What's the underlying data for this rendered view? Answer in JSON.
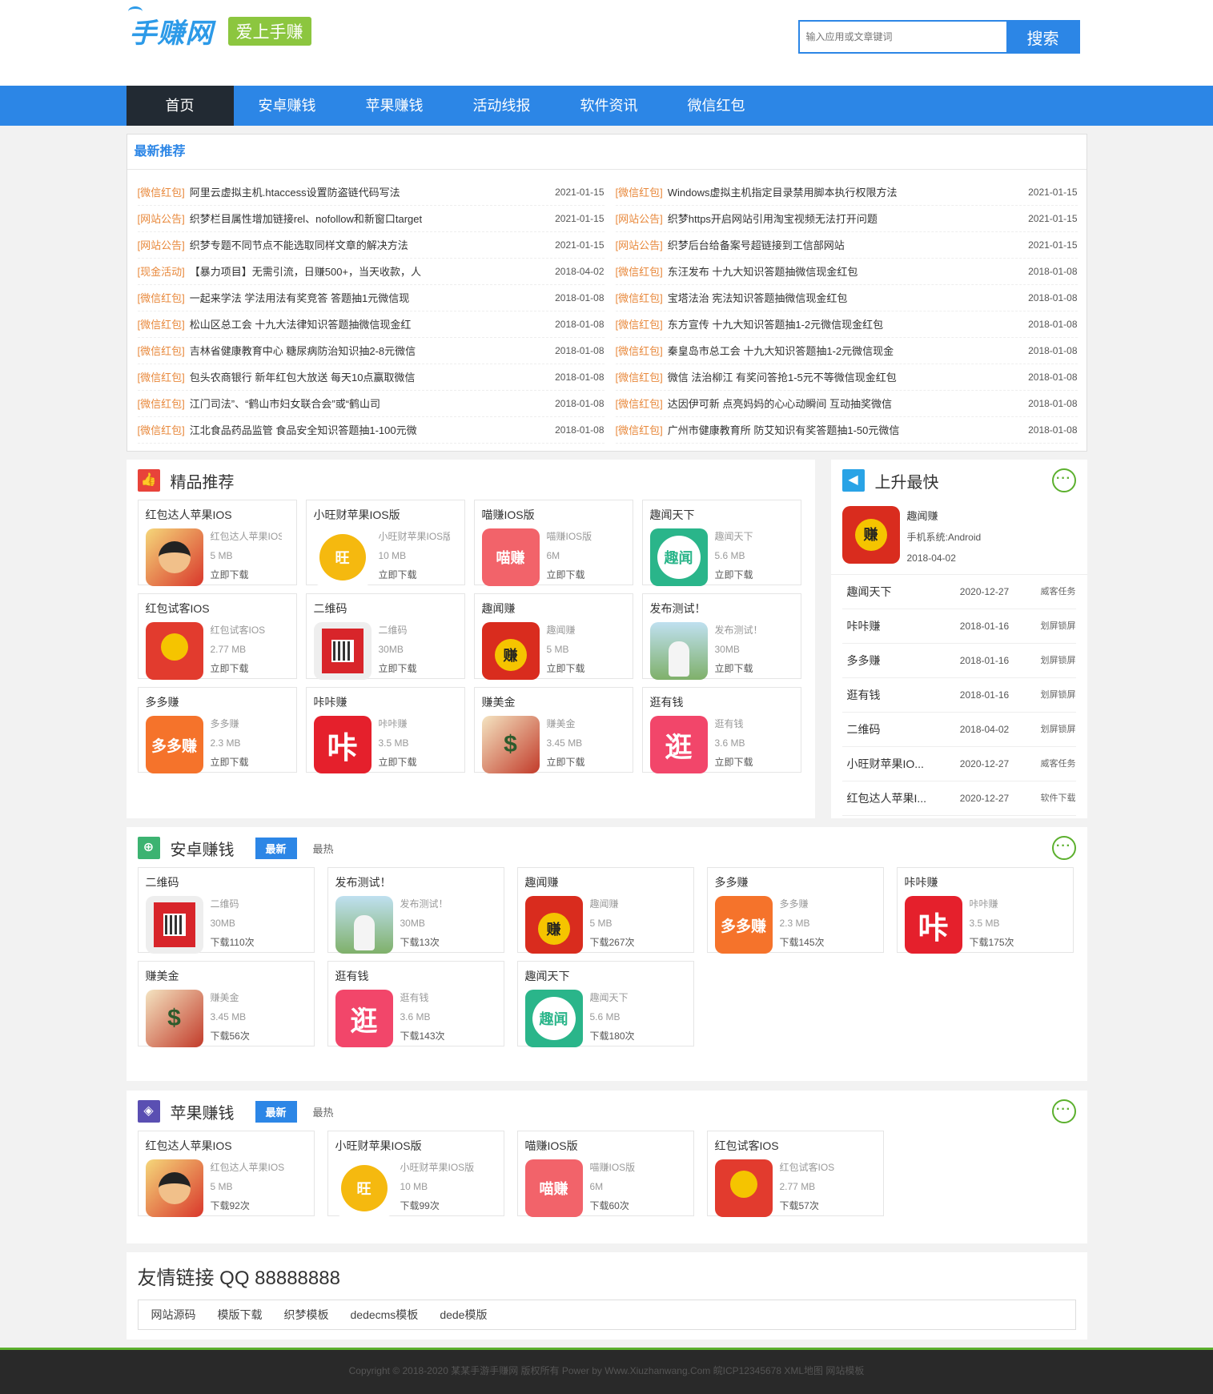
{
  "site": {
    "logo_text": "手赚网",
    "slogan": "爱上手赚",
    "search_placeholder": "输入应用或文章键词",
    "search_button": "搜索"
  },
  "nav": [
    "首页",
    "安卓赚钱",
    "苹果赚钱",
    "活动线报",
    "软件资讯",
    "微信红包"
  ],
  "latest": {
    "title": "最新推荐",
    "col1": [
      {
        "tag": "[微信红包]",
        "title": "阿里云虚拟主机.htaccess设置防盗链代码写法",
        "date": "2021-01-15"
      },
      {
        "tag": "[网站公告]",
        "title": "织梦栏目属性增加链接rel、nofollow和新窗口target",
        "date": "2021-01-15"
      },
      {
        "tag": "[网站公告]",
        "title": "织梦专题不同节点不能选取同样文章的解决方法",
        "date": "2021-01-15"
      },
      {
        "tag": "[现金活动]",
        "title": "【暴力项目】无需引流，日赚500+，当天收款，人",
        "date": "2018-04-02"
      },
      {
        "tag": "[微信红包]",
        "title": "一起来学法 学法用法有奖竞答 答题抽1元微信现",
        "date": "2018-01-08"
      },
      {
        "tag": "[微信红包]",
        "title": "松山区总工会 十九大法律知识答题抽微信现金红",
        "date": "2018-01-08"
      },
      {
        "tag": "[微信红包]",
        "title": "吉林省健康教育中心 糖尿病防治知识抽2-8元微信",
        "date": "2018-01-08"
      },
      {
        "tag": "[微信红包]",
        "title": "包头农商银行 新年红包大放送 每天10点赢取微信",
        "date": "2018-01-08"
      },
      {
        "tag": "[微信红包]",
        "title": "江门司法”、“鹤山市妇女联合会”或“鹤山司",
        "date": "2018-01-08"
      },
      {
        "tag": "[微信红包]",
        "title": "江北食品药品监管 食品安全知识答题抽1-100元微",
        "date": "2018-01-08"
      }
    ],
    "col2": [
      {
        "tag": "[微信红包]",
        "title": "Windows虚拟主机指定目录禁用脚本执行权限方法",
        "date": "2021-01-15"
      },
      {
        "tag": "[网站公告]",
        "title": "织梦https开启网站引用淘宝视频无法打开问题",
        "date": "2021-01-15"
      },
      {
        "tag": "[网站公告]",
        "title": "织梦后台给备案号超链接到工信部网站",
        "date": "2021-01-15"
      },
      {
        "tag": "[微信红包]",
        "title": "东汪发布 十九大知识答题抽微信现金红包",
        "date": "2018-01-08"
      },
      {
        "tag": "[微信红包]",
        "title": "宝塔法治 宪法知识答题抽微信现金红包",
        "date": "2018-01-08"
      },
      {
        "tag": "[微信红包]",
        "title": "东方宣传 十九大知识答题抽1-2元微信现金红包",
        "date": "2018-01-08"
      },
      {
        "tag": "[微信红包]",
        "title": "秦皇岛市总工会 十九大知识答题抽1-2元微信现金",
        "date": "2018-01-08"
      },
      {
        "tag": "[微信红包]",
        "title": "微信 法治柳江 有奖问答抢1-5元不等微信现金红包",
        "date": "2018-01-08"
      },
      {
        "tag": "[微信红包]",
        "title": "达因伊可新 点亮妈妈的心心动瞬间 互动抽奖微信",
        "date": "2018-01-08"
      },
      {
        "tag": "[微信红包]",
        "title": "广州市健康教育所 防艾知识有奖答题抽1-50元微信",
        "date": "2018-01-08"
      }
    ]
  },
  "featured": {
    "title": "精品推荐",
    "download_label": "立即下载",
    "apps": [
      {
        "name": "红包达人苹果IOS",
        "size": "5 MB",
        "icon": "hongbao-daren"
      },
      {
        "name": "小旺财苹果IOS版",
        "size": "10 MB",
        "icon": "xiaowangcai"
      },
      {
        "name": "喵赚IOS版",
        "size": "6M",
        "icon": "miaozhuan"
      },
      {
        "name": "趣闻天下",
        "size": "5.6 MB",
        "icon": "quwen-tianxia"
      },
      {
        "name": "红包试客IOS",
        "size": "2.77 MB",
        "icon": "hongbao-shike"
      },
      {
        "name": "二维码",
        "size": "30MB",
        "icon": "erweima"
      },
      {
        "name": "趣闻赚",
        "size": "5 MB",
        "icon": "quwen-zhuan"
      },
      {
        "name": "发布测试！",
        "size": "30MB",
        "icon": "photo-girl"
      },
      {
        "name": "多多赚",
        "size": "2.3 MB",
        "icon": "duoduozhuan"
      },
      {
        "name": "咔咔赚",
        "size": "3.5 MB",
        "icon": "kakazhuan"
      },
      {
        "name": "赚美金",
        "size": "3.45 MB",
        "icon": "zhuanmeijin"
      },
      {
        "name": "逛有钱",
        "size": "3.6 MB",
        "icon": "guangyouqian"
      }
    ]
  },
  "rank": {
    "title": "上升最快",
    "top": {
      "name": "趣闻赚",
      "system": "手机系统:Android",
      "date": "2018-04-02"
    },
    "items": [
      {
        "name": "趣闻天下",
        "date": "2020-12-27",
        "cat": "威客任务"
      },
      {
        "name": "咔咔赚",
        "date": "2018-01-16",
        "cat": "划屏锁屏"
      },
      {
        "name": "多多赚",
        "date": "2018-01-16",
        "cat": "划屏锁屏"
      },
      {
        "name": "逛有钱",
        "date": "2018-01-16",
        "cat": "划屏锁屏"
      },
      {
        "name": "二维码",
        "date": "2018-04-02",
        "cat": "划屏锁屏"
      },
      {
        "name": "小旺财苹果IO...",
        "date": "2020-12-27",
        "cat": "威客任务"
      },
      {
        "name": "红包达人苹果I...",
        "date": "2020-12-27",
        "cat": "软件下载"
      }
    ]
  },
  "android": {
    "title": "安卓赚钱",
    "tab_new": "最新",
    "tab_hot": "最热",
    "apps": [
      {
        "name": "二维码",
        "size": "30MB",
        "count": "下载110次",
        "icon": "erweima"
      },
      {
        "name": "发布测试！",
        "size": "30MB",
        "count": "下载13次",
        "icon": "photo-girl"
      },
      {
        "name": "趣闻赚",
        "size": "5 MB",
        "count": "下载267次",
        "icon": "quwen-zhuan"
      },
      {
        "name": "多多赚",
        "size": "2.3 MB",
        "count": "下载145次",
        "icon": "duoduozhuan"
      },
      {
        "name": "咔咔赚",
        "size": "3.5 MB",
        "count": "下载175次",
        "icon": "kakazhuan"
      },
      {
        "name": "赚美金",
        "size": "3.45 MB",
        "count": "下载56次",
        "icon": "zhuanmeijin"
      },
      {
        "name": "逛有钱",
        "size": "3.6 MB",
        "count": "下载143次",
        "icon": "guangyouqian"
      },
      {
        "name": "趣闻天下",
        "size": "5.6 MB",
        "count": "下载180次",
        "icon": "quwen-tianxia"
      }
    ]
  },
  "apple": {
    "title": "苹果赚钱",
    "tab_new": "最新",
    "tab_hot": "最热",
    "apps": [
      {
        "name": "红包达人苹果IOS",
        "size": "5 MB",
        "count": "下载92次",
        "icon": "hongbao-daren"
      },
      {
        "name": "小旺财苹果IOS版",
        "size": "10 MB",
        "count": "下载99次",
        "icon": "xiaowangcai"
      },
      {
        "name": "喵赚IOS版",
        "size": "6M",
        "count": "下载60次",
        "icon": "miaozhuan"
      },
      {
        "name": "红包试客IOS",
        "size": "2.77 MB",
        "count": "下载57次",
        "icon": "hongbao-shike"
      }
    ]
  },
  "links": {
    "title": "友情链接 QQ 88888888",
    "items": [
      "网站源码",
      "模版下载",
      "织梦模板",
      "dedecms模板",
      "dede模版"
    ]
  },
  "footer": {
    "text": "Copyright © 2018-2020 某某手游手赚网 版权所有 Power by Www.Xiuzhanwang.Com 皖ICP12345678 XML地图 网站模板"
  },
  "icon_glyphs": {
    "hongbao-daren": "",
    "xiaowangcai": "旺",
    "miaozhuan": "喵赚",
    "quwen-tianxia": "趣闻",
    "hongbao-shike": "",
    "erweima": "",
    "quwen-zhuan": "赚",
    "photo-girl": "",
    "duoduozhuan": "多多赚",
    "kakazhuan": "咔",
    "zhuanmeijin": "$",
    "guangyouqian": "逛"
  },
  "colors": {
    "accent": "#2c86e6",
    "nav_active": "#222a33",
    "tag": "#e8883b",
    "more": "#5cb02e",
    "slogan": "#8cc63f"
  }
}
